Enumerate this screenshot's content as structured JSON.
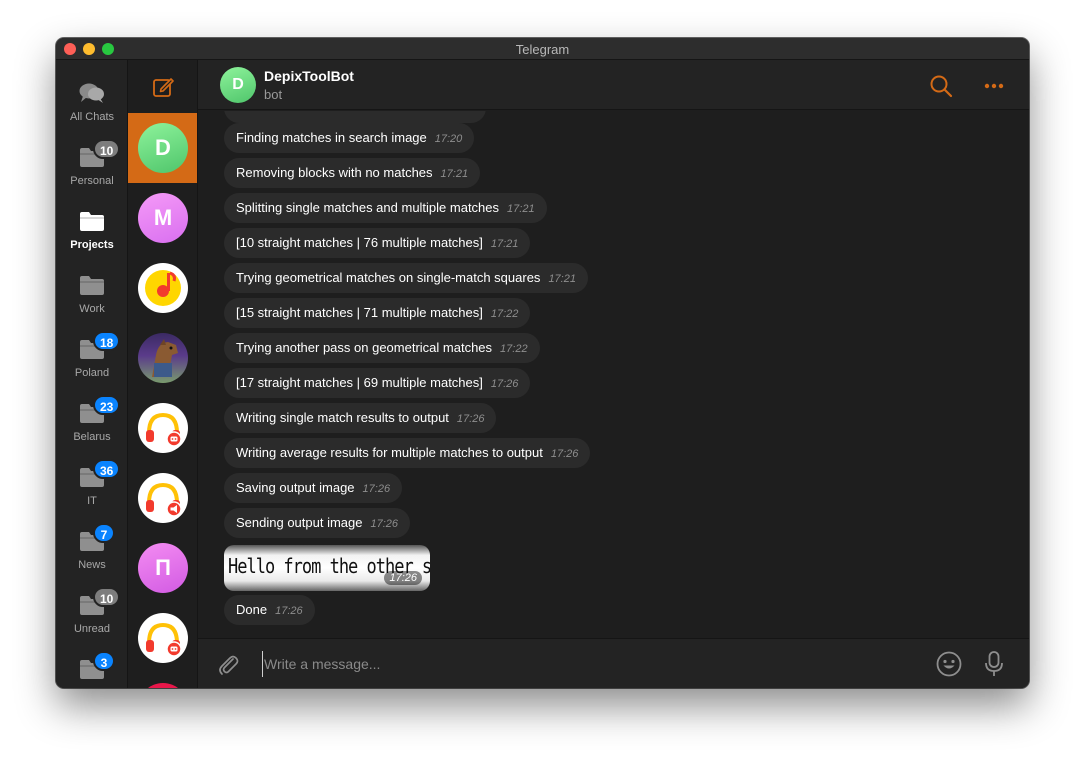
{
  "window": {
    "title": "Telegram"
  },
  "folders": [
    {
      "label": "All Chats",
      "badge": "",
      "icon": "chats-icon",
      "active": false
    },
    {
      "label": "Personal",
      "badge": "10",
      "icon": "folder-icon",
      "active": false
    },
    {
      "label": "Projects",
      "badge": "",
      "icon": "folder-icon",
      "active": true
    },
    {
      "label": "Work",
      "badge": "",
      "icon": "folder-icon",
      "active": false
    },
    {
      "label": "Poland",
      "badge": "18",
      "icon": "folder-icon",
      "active": false
    },
    {
      "label": "Belarus",
      "badge": "23",
      "icon": "folder-icon",
      "active": false
    },
    {
      "label": "IT",
      "badge": "36",
      "icon": "folder-icon",
      "active": false
    },
    {
      "label": "News",
      "badge": "7",
      "icon": "folder-icon",
      "active": false
    },
    {
      "label": "Unread",
      "badge": "10",
      "icon": "folder-icon",
      "active": false
    },
    {
      "label": "",
      "badge": "3",
      "icon": "folder-icon",
      "active": false
    }
  ],
  "chat_avatars": [
    {
      "letter": "D",
      "kind": "letter-green"
    },
    {
      "letter": "M",
      "kind": "letter-pink"
    },
    {
      "letter": "",
      "kind": "music-logo"
    },
    {
      "letter": "",
      "kind": "photo-horse"
    },
    {
      "letter": "",
      "kind": "headphones-bot"
    },
    {
      "letter": "",
      "kind": "headphones-megaphone"
    },
    {
      "letter": "П",
      "kind": "letter-pink"
    },
    {
      "letter": "",
      "kind": "headphones-bot"
    }
  ],
  "header": {
    "avatar_letter": "D",
    "name": "DepixToolBot",
    "status": "bot"
  },
  "messages": [
    {
      "text": "Finding matches in search image",
      "time": "17:20"
    },
    {
      "text": "Removing blocks with no matches",
      "time": "17:21"
    },
    {
      "text": "Splitting single matches and multiple matches",
      "time": "17:21"
    },
    {
      "text": "[10 straight matches | 76 multiple matches]",
      "time": "17:21"
    },
    {
      "text": "Trying geometrical matches on single-match squares",
      "time": "17:21"
    },
    {
      "text": "[15 straight matches | 71 multiple matches]",
      "time": "17:22"
    },
    {
      "text": "Trying another pass on geometrical matches",
      "time": "17:22"
    },
    {
      "text": "[17 straight matches | 69 multiple matches]",
      "time": "17:26"
    },
    {
      "text": "Writing single match results to output",
      "time": "17:26"
    },
    {
      "text": "Writing average results for multiple matches to output",
      "time": "17:26"
    },
    {
      "text": "Saving output image",
      "time": "17:26"
    },
    {
      "text": "Sending output image",
      "time": "17:26"
    }
  ],
  "image_message": {
    "text": "Hello from the other side",
    "time": "17:26"
  },
  "last_message": {
    "text": "Done",
    "time": "17:26"
  },
  "composer": {
    "placeholder": "Write a message..."
  },
  "colors": {
    "accent": "#d46a16",
    "badge": "#0a84ff",
    "badge_muted": "#7d7d7d",
    "bubble": "#2b2b2b",
    "background": "#1e1e1e"
  }
}
